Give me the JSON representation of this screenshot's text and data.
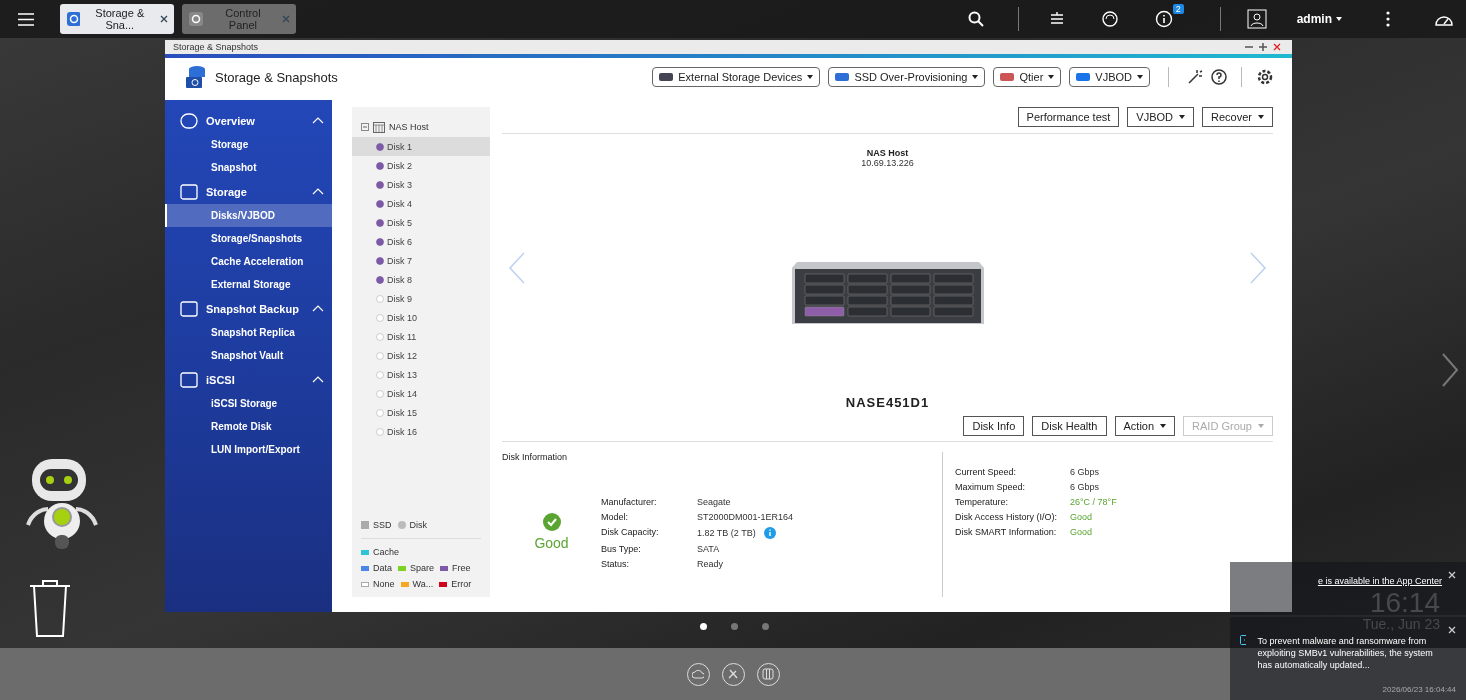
{
  "taskbar": {
    "tabs": [
      {
        "label": "Storage & Sna...",
        "selected": true
      },
      {
        "label": "Control Panel",
        "selected": false
      }
    ],
    "notification_count": "2",
    "user": "admin"
  },
  "window": {
    "title": "Storage & Snapshots",
    "app_title": "Storage & Snapshots",
    "header_menus": [
      {
        "label": "External Storage Devices"
      },
      {
        "label": "SSD Over-Provisioning"
      },
      {
        "label": "Qtier"
      },
      {
        "label": "VJBOD"
      }
    ],
    "sidebar": [
      {
        "label": "Overview",
        "expanded": true,
        "items": [
          {
            "label": "Storage",
            "selected": false
          },
          {
            "label": "Snapshot",
            "selected": false
          }
        ]
      },
      {
        "label": "Storage",
        "expanded": true,
        "items": [
          {
            "label": "Disks/VJBOD",
            "selected": true
          },
          {
            "label": "Storage/Snapshots",
            "selected": false
          },
          {
            "label": "Cache Acceleration",
            "selected": false
          },
          {
            "label": "External Storage",
            "selected": false
          }
        ]
      },
      {
        "label": "Snapshot Backup",
        "expanded": true,
        "items": [
          {
            "label": "Snapshot Replica",
            "selected": false
          },
          {
            "label": "Snapshot Vault",
            "selected": false
          }
        ]
      },
      {
        "label": "iSCSI",
        "expanded": true,
        "items": [
          {
            "label": "iSCSI Storage",
            "selected": false
          },
          {
            "label": "Remote Disk",
            "selected": false
          },
          {
            "label": "LUN Import/Export",
            "selected": false
          }
        ]
      }
    ],
    "tree": {
      "root": "NAS Host",
      "expanded": true,
      "children": [
        {
          "label": "Disk 1",
          "filled": true,
          "selected": true
        },
        {
          "label": "Disk 2",
          "filled": true,
          "selected": false
        },
        {
          "label": "Disk 3",
          "filled": true,
          "selected": false
        },
        {
          "label": "Disk 4",
          "filled": true,
          "selected": false
        },
        {
          "label": "Disk 5",
          "filled": true,
          "selected": false
        },
        {
          "label": "Disk 6",
          "filled": true,
          "selected": false
        },
        {
          "label": "Disk 7",
          "filled": true,
          "selected": false
        },
        {
          "label": "Disk 8",
          "filled": true,
          "selected": false
        },
        {
          "label": "Disk 9",
          "filled": false,
          "selected": false
        },
        {
          "label": "Disk 10",
          "filled": false,
          "selected": false
        },
        {
          "label": "Disk 11",
          "filled": false,
          "selected": false
        },
        {
          "label": "Disk 12",
          "filled": false,
          "selected": false
        },
        {
          "label": "Disk 13",
          "filled": false,
          "selected": false
        },
        {
          "label": "Disk 14",
          "filled": false,
          "selected": false
        },
        {
          "label": "Disk 15",
          "filled": false,
          "selected": false
        },
        {
          "label": "Disk 16",
          "filled": false,
          "selected": false
        }
      ]
    },
    "type_legend": [
      {
        "label": "SSD",
        "kind": "square"
      },
      {
        "label": "Disk",
        "kind": "circle"
      }
    ],
    "color_legend": [
      [
        {
          "label": "Cache",
          "color": "#2ec4d6"
        }
      ],
      [
        {
          "label": "Data",
          "color": "#4a86e8"
        },
        {
          "label": "Spare",
          "color": "#7ed321"
        },
        {
          "label": "Free",
          "color": "#7d5aa6"
        }
      ],
      [
        {
          "label": "None",
          "color": "#ffffff"
        },
        {
          "label": "Wa...",
          "color": "#f5a623"
        },
        {
          "label": "Error",
          "color": "#d0021b"
        }
      ]
    ],
    "top_actions": [
      {
        "label": "Performance test",
        "dropdown": false,
        "disabled": false
      },
      {
        "label": "VJBOD",
        "dropdown": true,
        "disabled": false
      },
      {
        "label": "Recover",
        "dropdown": true,
        "disabled": false
      }
    ],
    "device": {
      "name": "NAS Host",
      "address": "10.69.13.226",
      "model": "NASE451D1"
    },
    "disk_actions": [
      {
        "label": "Disk Info",
        "dropdown": false,
        "disabled": false
      },
      {
        "label": "Disk Health",
        "dropdown": false,
        "disabled": false
      },
      {
        "label": "Action",
        "dropdown": true,
        "disabled": false
      },
      {
        "label": "RAID Group",
        "dropdown": true,
        "disabled": true
      }
    ],
    "disk_information": {
      "title": "Disk Information",
      "health": "Good",
      "left": [
        {
          "label": "Manufacturer:",
          "value": "Seagate",
          "highlight": false,
          "info": false
        },
        {
          "label": "Model:",
          "value": "ST2000DM001-1ER164",
          "highlight": false,
          "info": false
        },
        {
          "label": "Disk Capacity:",
          "value": "1.82 TB (2 TB)",
          "highlight": false,
          "info": true
        },
        {
          "label": "Bus Type:",
          "value": "SATA",
          "highlight": false,
          "info": false
        },
        {
          "label": "Status:",
          "value": "Ready",
          "highlight": false,
          "info": false
        }
      ],
      "right": [
        {
          "label": "Current Speed:",
          "value": "6 Gbps",
          "highlight": false,
          "info": false
        },
        {
          "label": "Maximum Speed:",
          "value": "6 Gbps",
          "highlight": false,
          "info": false
        },
        {
          "label": "Temperature:",
          "value": "26°C / 78°F",
          "highlight": true,
          "info": false
        },
        {
          "label": "Disk Access History (I/O):",
          "value": "Good",
          "highlight": true,
          "info": false
        },
        {
          "label": "Disk SMART Information:",
          "value": "Good",
          "highlight": true,
          "info": false
        }
      ]
    }
  },
  "clock": {
    "time": "16:14",
    "date": "Tue., Jun 23"
  },
  "notifications": [
    {
      "text": "e is available in the App Center",
      "kind": "link"
    },
    {
      "text": "To prevent malware and ransomware from exploiting SMBv1 vulnerabilities, the system has automatically updated...",
      "kind": "message",
      "time": "2026/06/23 16:04:44"
    }
  ],
  "pages": [
    {
      "selected": true
    },
    {
      "selected": false
    },
    {
      "selected": false
    }
  ]
}
